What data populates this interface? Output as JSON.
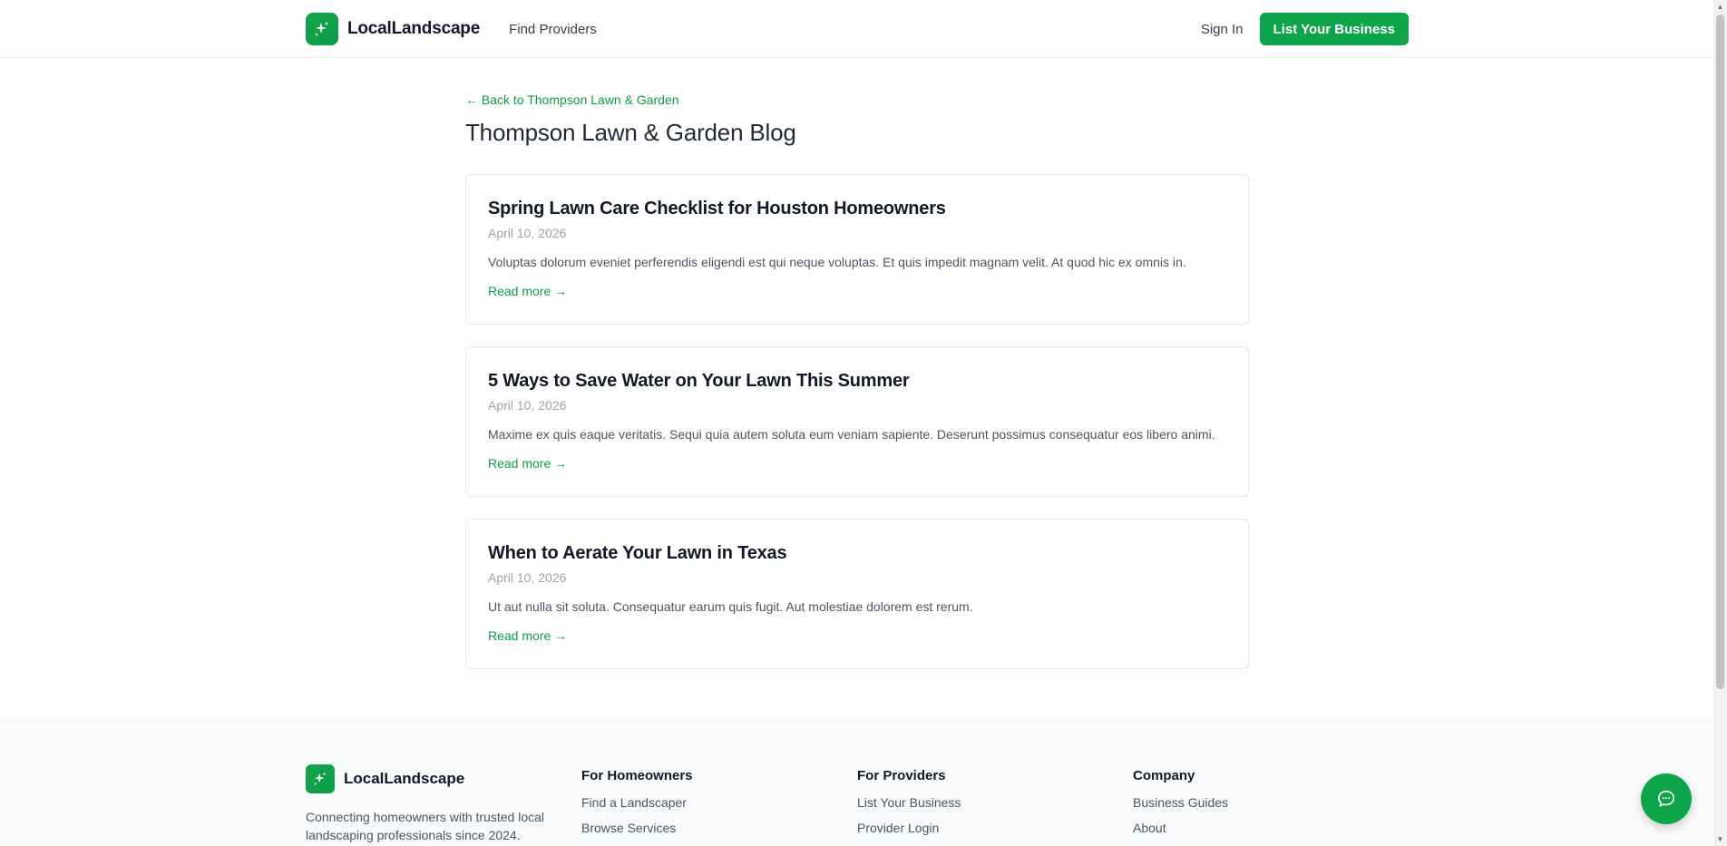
{
  "header": {
    "brand_name": "LocalLandscape",
    "nav_find_providers": "Find Providers",
    "sign_in": "Sign In",
    "cta": "List Your Business"
  },
  "main": {
    "back_link": "← Back to Thompson Lawn & Garden",
    "title": "Thompson Lawn & Garden Blog",
    "posts": [
      {
        "title": "Spring Lawn Care Checklist for Houston Homeowners",
        "date": "April 10, 2026",
        "excerpt": "Voluptas dolorum eveniet perferendis eligendi est qui neque voluptas. Et quis impedit magnam velit. At quod hic ex omnis in.",
        "read_more": "Read more →"
      },
      {
        "title": "5 Ways to Save Water on Your Lawn This Summer",
        "date": "April 10, 2026",
        "excerpt": "Maxime ex quis eaque veritatis. Sequi quia autem soluta eum veniam sapiente. Deserunt possimus consequatur eos libero animi.",
        "read_more": "Read more →"
      },
      {
        "title": "When to Aerate Your Lawn in Texas",
        "date": "April 10, 2026",
        "excerpt": "Ut aut nulla sit soluta. Consequatur earum quis fugit. Aut molestiae dolorem est rerum.",
        "read_more": "Read more →"
      }
    ]
  },
  "footer": {
    "brand_name": "LocalLandscape",
    "tagline": "Connecting homeowners with trusted local landscaping professionals since 2024.",
    "columns": [
      {
        "heading": "For Homeowners",
        "links": [
          "Find a Landscaper",
          "Browse Services"
        ]
      },
      {
        "heading": "For Providers",
        "links": [
          "List Your Business",
          "Provider Login"
        ]
      },
      {
        "heading": "Company",
        "links": [
          "Business Guides",
          "About"
        ]
      }
    ]
  },
  "icons": {
    "logo": "sparkle-icon",
    "chat": "chat-bubble-icon"
  },
  "colors": {
    "accent": "#0ea44a",
    "link": "#0b9e49",
    "text": "#1f2937",
    "muted": "#9ca3af",
    "footer_bg": "#f9fafb"
  }
}
